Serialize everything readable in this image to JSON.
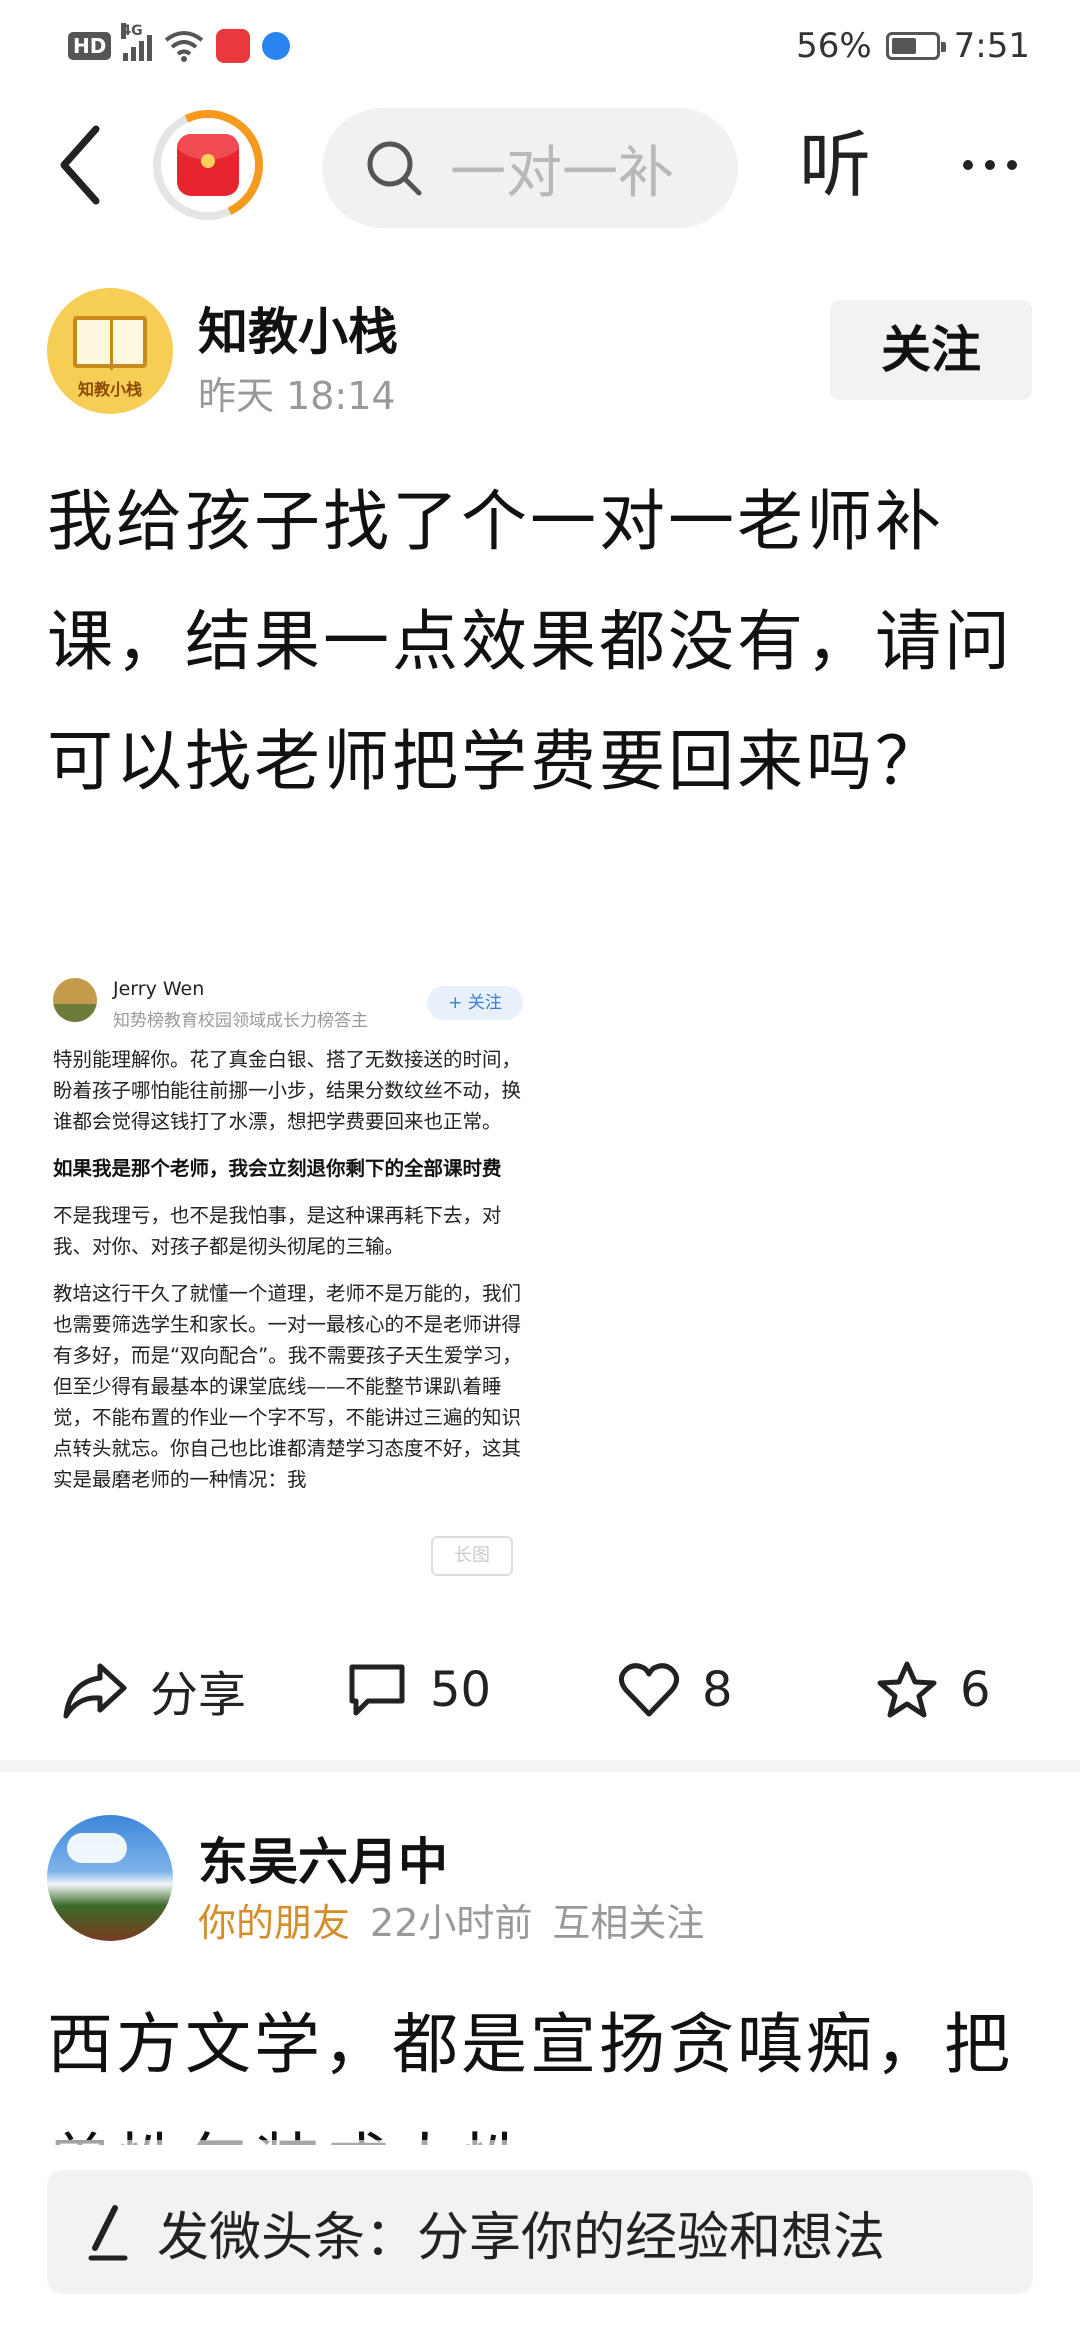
{
  "status_bar": {
    "hd": "HD",
    "network": "4G",
    "battery_text": "56%",
    "battery_level": 0.56,
    "time": "7:51"
  },
  "top_bar": {
    "search_placeholder": "一对一补",
    "listen_label": "听"
  },
  "post1": {
    "author": "知教小栈",
    "avatar_text": "知教小栈",
    "time": "昨天  18:14",
    "follow_label": "关注",
    "title": "我给孩子找了个一对一老师补课，结果一点效果都没有，请问可以找老师把学费要回来吗？",
    "embedded": {
      "name": "Jerry Wen",
      "subtitle": "知势榜教育校园领域成长力榜答主",
      "follow": "+ 关注",
      "p1": "特别能理解你。花了真金白银、搭了无数接送的时间，盼着孩子哪怕能往前挪一小步，结果分数纹丝不动，换谁都会觉得这钱打了水漂，想把学费要回来也正常。",
      "p2": "如果我是那个老师，我会立刻退你剩下的全部课时费",
      "p3": "不是我理亏，也不是我怕事，是这种课再耗下去，对我、对你、对孩子都是彻头彻尾的三输。",
      "p4": "教培这行干久了就懂一个道理，老师不是万能的，我们也需要筛选学生和家长。一对一最核心的不是老师讲得有多好，而是“双向配合”。我不需要孩子天生爱学习，但至少得有最基本的课堂底线——不能整节课趴着睡觉，不能布置的作业一个字不写，不能讲过三遍的知识点转头就忘。你自己也比谁都清楚学习态度不好，这其实是最磨老师的一种情况：我",
      "watermark": "长图"
    },
    "actions": {
      "share": "分享",
      "comments": "50",
      "likes": "8",
      "favorites": "6"
    }
  },
  "post2": {
    "author": "东吴六月中",
    "relation": "你的朋友",
    "time_ago": "22小时前",
    "mutual": "互相关注",
    "title": "西方文学，都是宣扬贪嗔痴，把兽性包装成人性"
  },
  "composer": {
    "placeholder": "发微头条：分享你的经验和想法"
  }
}
